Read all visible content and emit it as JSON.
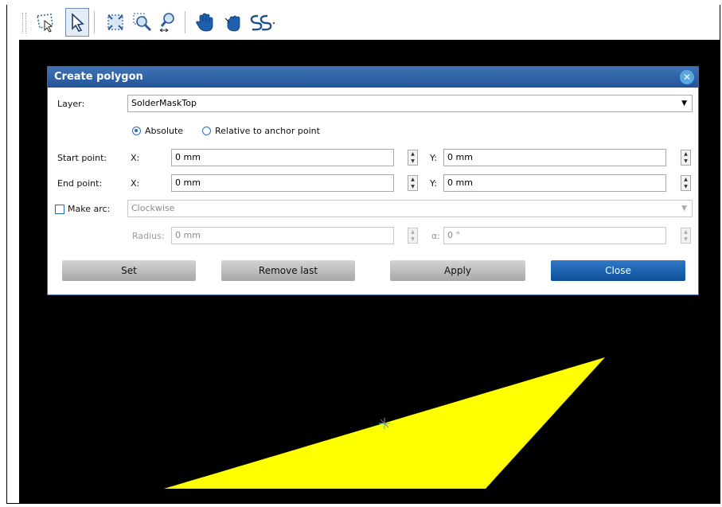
{
  "toolbar": {
    "tools": [
      {
        "icon": "lasso-select-icon"
      },
      {
        "icon": "pointer-select-icon"
      },
      {
        "icon": "zoom-fit-icon"
      },
      {
        "icon": "zoom-window-icon"
      },
      {
        "icon": "zoom-pan-icon"
      },
      {
        "icon": "hand-pan-icon"
      },
      {
        "icon": "hand-grab-icon"
      },
      {
        "icon": "snap-icon"
      }
    ]
  },
  "dialog": {
    "title": "Create polygon",
    "layer_label": "Layer:",
    "layer_value": "SolderMaskTop",
    "mode": {
      "absolute": "Absolute",
      "relative": "Relative to anchor point",
      "selected": "Absolute"
    },
    "start_label": "Start point:",
    "end_label": "End point:",
    "x_label": "X:",
    "y_label": "Y:",
    "start_x": "0 mm",
    "start_y": "0 mm",
    "end_x": "0 mm",
    "end_y": "0 mm",
    "make_arc_label": "Make arc:",
    "make_arc_checked": false,
    "arc_direction": "Clockwise",
    "radius_label": "Radius:",
    "radius_value": "0 mm",
    "alpha_label": "α:",
    "alpha_value": "0 °",
    "buttons": {
      "set": "Set",
      "remove_last": "Remove last",
      "apply": "Apply",
      "close": "Close"
    }
  },
  "canvas": {
    "background": "#000000",
    "polygon_color": "#ffff00",
    "cursor_color": "#22ccaa"
  }
}
